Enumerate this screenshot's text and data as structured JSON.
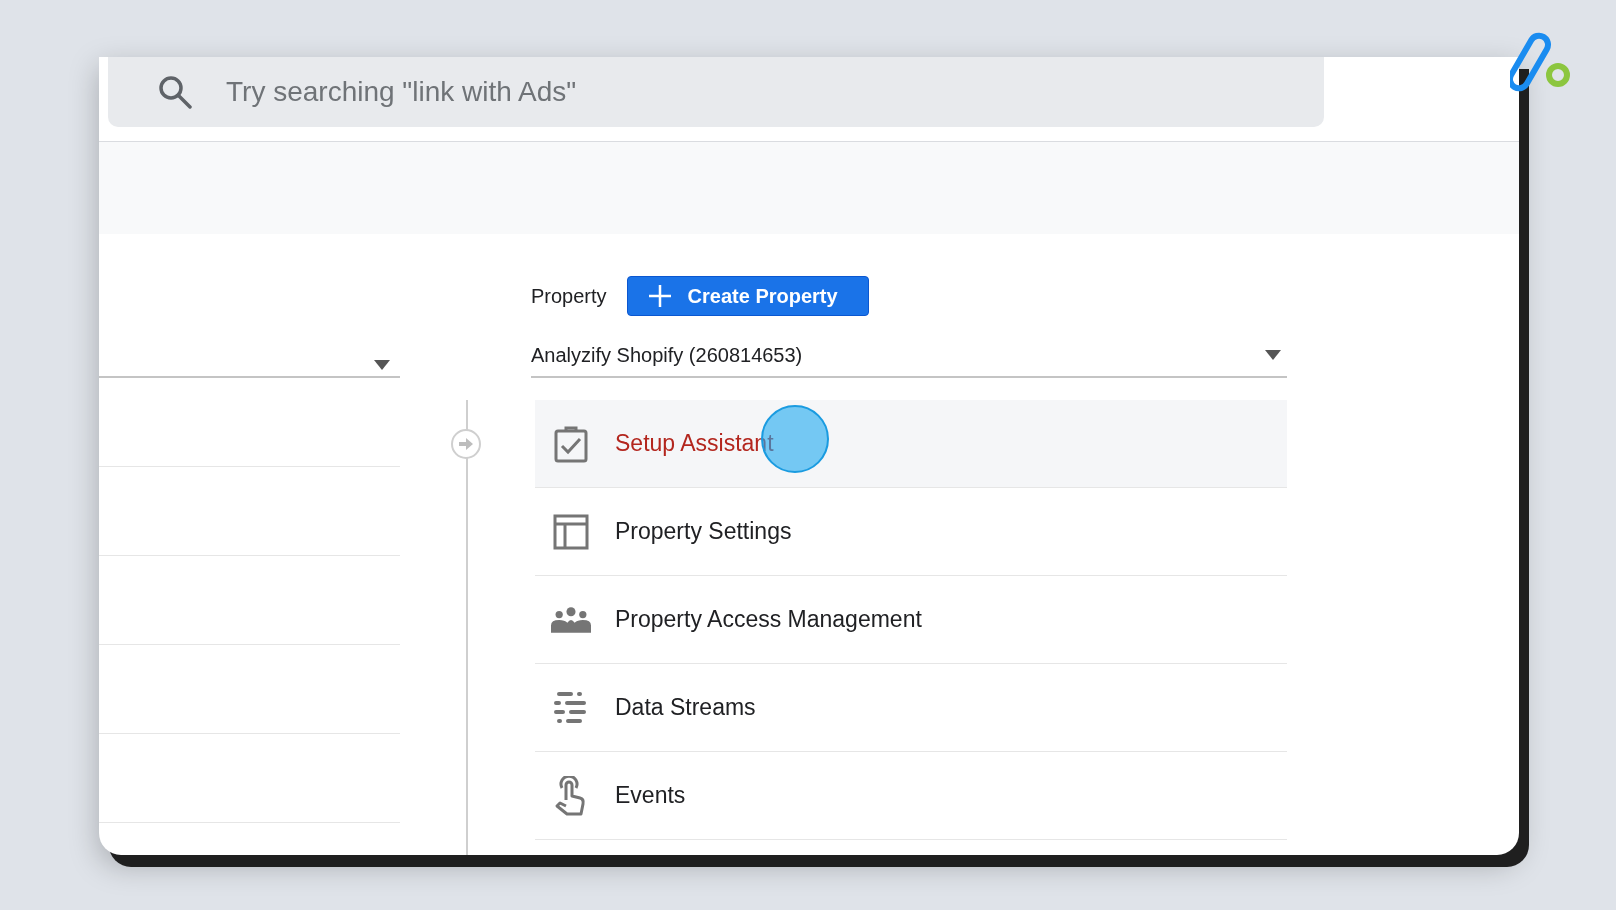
{
  "search": {
    "placeholder": "Try searching \"link with Ads\""
  },
  "property": {
    "label": "Property",
    "create_button": "Create Property",
    "selector": "Analyzify Shopify (260814653)"
  },
  "menu": [
    {
      "label": "Setup Assistant",
      "kind": "checklist",
      "selected": true
    },
    {
      "label": "Property Settings",
      "kind": "layout",
      "selected": false
    },
    {
      "label": "Property Access Management",
      "kind": "people",
      "selected": false
    },
    {
      "label": "Data Streams",
      "kind": "streams",
      "selected": false
    },
    {
      "label": "Events",
      "kind": "touch",
      "selected": false
    }
  ]
}
